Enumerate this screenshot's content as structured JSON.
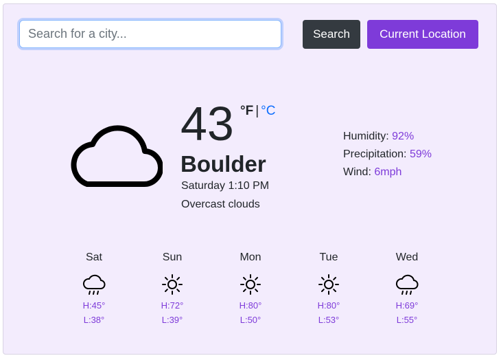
{
  "search": {
    "placeholder": "Search for a city..."
  },
  "buttons": {
    "search_label": "Search",
    "location_label": "Current Location"
  },
  "current": {
    "temperature": "43",
    "unit_f": "°F",
    "separator": "|",
    "unit_c": "°C",
    "city": "Boulder",
    "datetime": "Saturday 1:10 PM",
    "condition": "Overcast clouds",
    "icon": "cloud-icon"
  },
  "stats": {
    "humidity_label": "Humidity:",
    "humidity_value": "92%",
    "precipitation_label": "Precipitation:",
    "precipitation_value": "59%",
    "wind_label": "Wind:",
    "wind_value": "6mph"
  },
  "forecast": [
    {
      "day": "Sat",
      "icon": "rain-cloud-icon",
      "high": "H:45°",
      "low": "L:38°"
    },
    {
      "day": "Sun",
      "icon": "sun-icon",
      "high": "H:72°",
      "low": "L:39°"
    },
    {
      "day": "Mon",
      "icon": "sun-icon",
      "high": "H:80°",
      "low": "L:50°"
    },
    {
      "day": "Tue",
      "icon": "sun-icon",
      "high": "H:80°",
      "low": "L:53°"
    },
    {
      "day": "Wed",
      "icon": "rain-cloud-icon",
      "high": "H:69°",
      "low": "L:55°"
    }
  ],
  "colors": {
    "accent": "#7e3bd9",
    "card_bg": "#f3ecfd",
    "dark_button": "#343a40",
    "link": "#0d6efd"
  }
}
